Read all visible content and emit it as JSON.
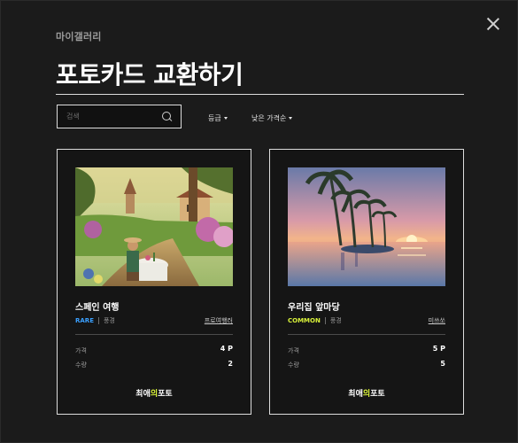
{
  "modal": {
    "brand": "마이갤러리",
    "title": "포토카드 교환하기",
    "search": {
      "placeholder": "검색"
    },
    "filters": [
      {
        "label": "등급"
      },
      {
        "label": "낮은 가격순"
      }
    ],
    "labels": {
      "price": "가격",
      "quantity": "수량"
    },
    "footer_logo": {
      "part1": "최애",
      "part2": "의",
      "part3": "포토"
    },
    "colors": {
      "rare": "#3aa0ff",
      "common": "#d9f23a",
      "accent": "#d9f23a"
    }
  },
  "cards": [
    {
      "name": "스페인 여행",
      "grade": "RARE",
      "genre": "풍경",
      "owner": "프로여행러",
      "price": "4 P",
      "quantity": "2"
    },
    {
      "name": "우리집 앞마당",
      "grade": "COMMON",
      "genre": "풍경",
      "owner": "미쓰쏘",
      "price": "5 P",
      "quantity": "5"
    }
  ]
}
